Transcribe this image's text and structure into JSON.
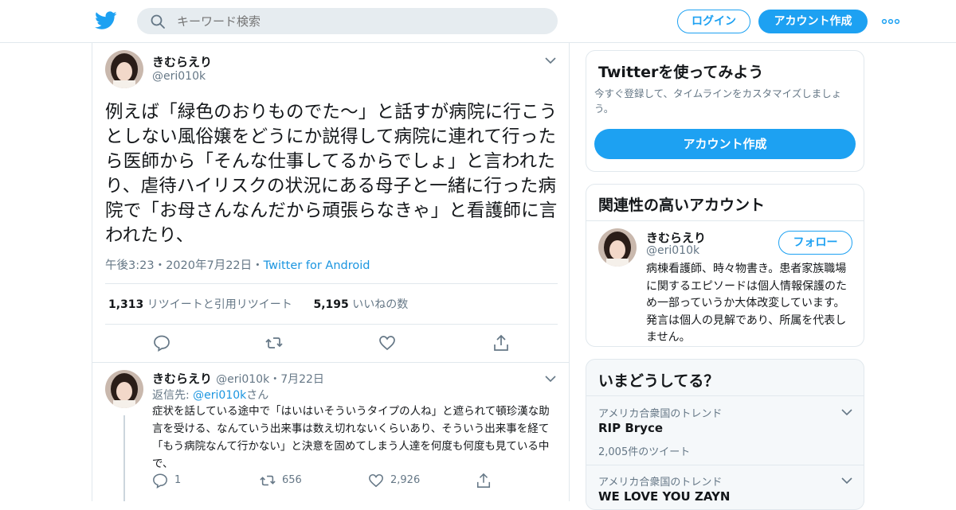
{
  "header": {
    "search_placeholder": "キーワード検索",
    "login_label": "ログイン",
    "signup_label": "アカウント作成",
    "brand_color": "#1da1f2"
  },
  "tweet": {
    "name": "きむらえり",
    "handle": "@eri010k",
    "text": "例えば「緑色のおりものでた〜」と話すが病院に行こうとしない風俗嬢をどうにか説得して病院に連れて行ったら医師から「そんな仕事してるからでしょ」と言われたり、虐待ハイリスクの状況にある母子と一緒に行った病院で「お母さんなんだから頑張らなきゃ」と看護師に言われたり、",
    "time": "午後3:23",
    "date": "2020年7月22日",
    "sep": "・",
    "source": "Twitter for Android",
    "retweets": "1,313",
    "retweets_label": "リツイートと引用リツイート",
    "likes": "5,195",
    "likes_label": "いいねの数"
  },
  "reply": {
    "name": "きむらえり",
    "handle": "@eri010k",
    "sep": "・",
    "date": "7月22日",
    "reply_prefix": "返信先: ",
    "reply_handle": "@eri010k",
    "reply_suffix": "さん",
    "text": "症状を話している途中で「はいはいそういうタイプの人ね」と遮られて頓珍漢な助言を受ける、なんていう出来事は数え切れないくらいあり、そういう出来事を経て「もう病院なんて行かない」と決意を固めてしまう人達を何度も何度も見ている中で、",
    "replies": "1",
    "retweets": "656",
    "likes": "2,926"
  },
  "signup_card": {
    "title": "Twitterを使ってみよう",
    "subtitle": "今すぐ登録して、タイムラインをカスタマイズしましょう。",
    "button": "アカウント作成"
  },
  "related_card": {
    "title": "関連性の高いアカウント",
    "name": "きむらえり",
    "handle": "@eri010k",
    "follow": "フォロー",
    "bio": "病棟看護師、時々物書き。患者家族職場に関するエピソードは個人情報保護のため一部っていうか大体改変しています。発言は個人の見解であり、所属を代表しません。"
  },
  "trends": {
    "title": "いまどうしてる？",
    "items": [
      {
        "category": "アメリカ合衆国のトレンド",
        "name": "RIP Bryce",
        "count": "2,005件のツイート"
      },
      {
        "category": "アメリカ合衆国のトレンド",
        "name": "WE LOVE YOU ZAYN"
      }
    ]
  }
}
